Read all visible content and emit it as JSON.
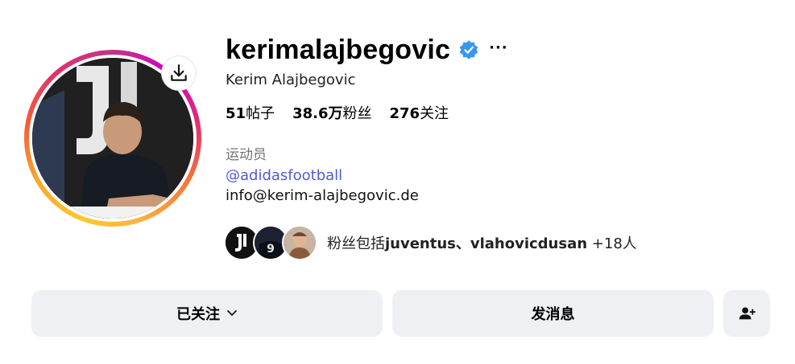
{
  "profile": {
    "username": "kerimalajbegovic",
    "full_name": "Kerim Alajbegovic",
    "verified": true,
    "more_label": "···"
  },
  "stats": {
    "posts_value": "51",
    "posts_label": "帖子",
    "followers_value": "38.6万",
    "followers_label": "粉丝",
    "following_value": "276",
    "following_label": "关注"
  },
  "bio": {
    "category": "运动员",
    "link": "@adidasfootball",
    "text": "info@kerim-alajbegovic.de"
  },
  "followed_by": {
    "prefix": "粉丝包括",
    "names": "juventus、vlahovicdusan",
    "suffix": " +18人"
  },
  "buttons": {
    "following_label": "已关注",
    "message_label": "发消息"
  },
  "icons": {
    "download": "download-icon",
    "verified": "verified-badge-icon",
    "chevron": "chevron-down-icon",
    "add_person": "add-person-icon"
  },
  "colors": {
    "verified_blue": "#3897f0",
    "link_blue": "#4f5bd5",
    "button_bg": "#eff0f4",
    "muted_text": "#737373"
  }
}
